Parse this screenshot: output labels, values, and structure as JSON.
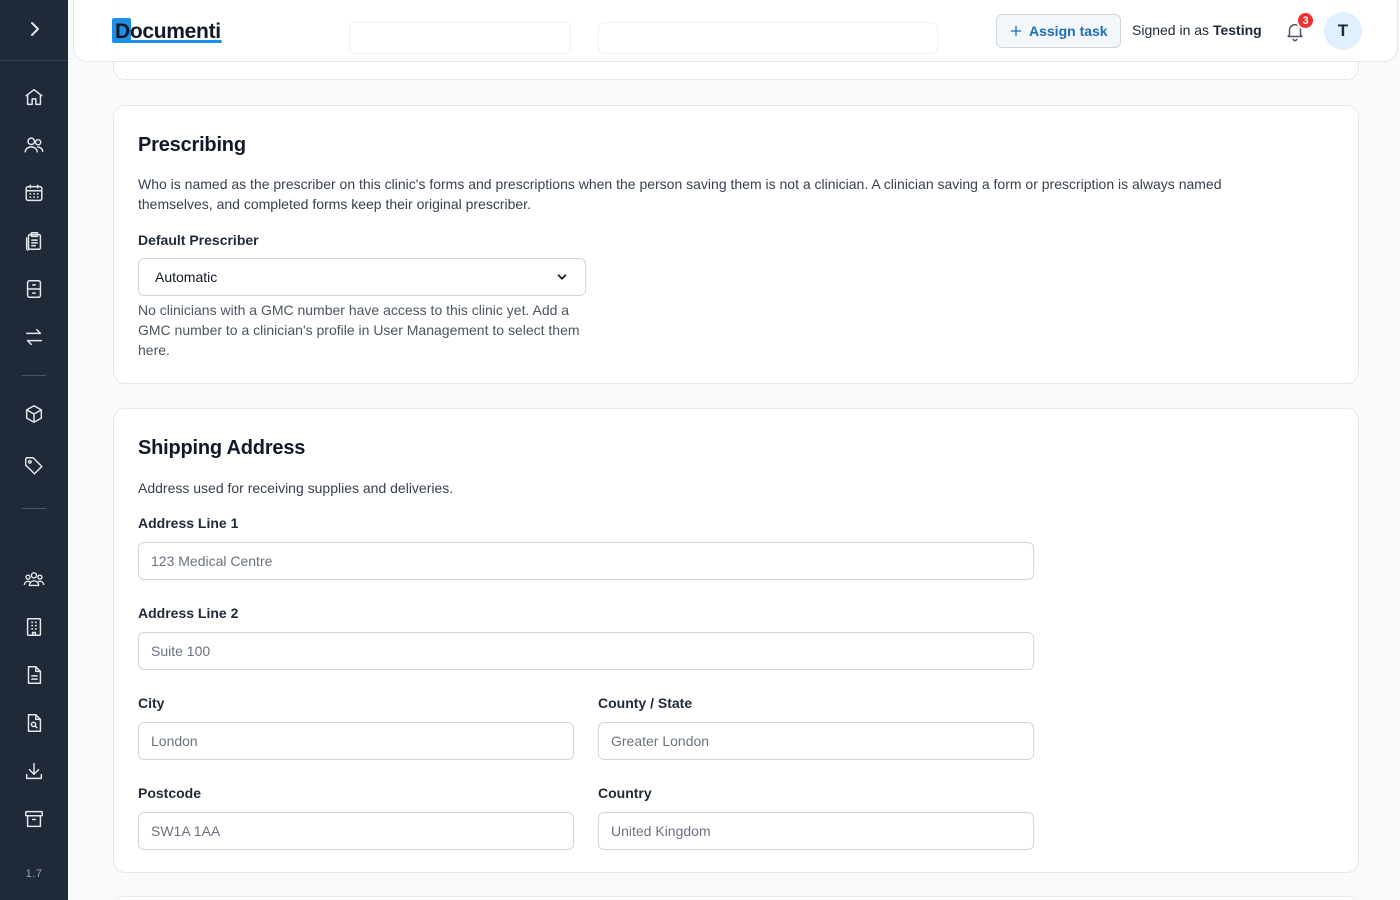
{
  "app": {
    "name": "Documenti",
    "version": "1.7"
  },
  "sidebar": {
    "items": [
      {
        "icon": "home-icon",
        "label": "Home"
      },
      {
        "icon": "users-icon",
        "label": "Patients"
      },
      {
        "icon": "calendar-icon",
        "label": "Calendar"
      },
      {
        "icon": "clipboard-icon",
        "label": "Forms"
      },
      {
        "icon": "cabinet-icon",
        "label": "Records"
      },
      {
        "icon": "transfer-icon",
        "label": "Transfers"
      },
      {
        "icon": "box-icon",
        "label": "Inventory"
      },
      {
        "icon": "tag-icon",
        "label": "Products"
      },
      {
        "icon": "team-icon",
        "label": "Team"
      },
      {
        "icon": "building-icon",
        "label": "Clinics"
      },
      {
        "icon": "document-icon",
        "label": "Documents"
      },
      {
        "icon": "search-document-icon",
        "label": "Audit"
      },
      {
        "icon": "download-icon",
        "label": "Downloads"
      },
      {
        "icon": "archive-icon",
        "label": "Archive"
      }
    ]
  },
  "header": {
    "assign_task_label": "Assign task",
    "signed_in_prefix": "Signed in as",
    "user_name": "Testing",
    "notification_count": "3",
    "avatar_initial": "T"
  },
  "prescribing": {
    "title": "Prescribing",
    "description": "Who is named as the prescriber on this clinic's forms and prescriptions when the person saving them is not a clinician. A clinician saving a form or prescription is always named themselves, and completed forms keep their original prescriber.",
    "default_prescriber_label": "Default Prescriber",
    "default_prescriber_value": "Automatic",
    "helper_text": "No clinicians with a GMC number have access to this clinic yet. Add a GMC number to a clinician's profile in User Management to select them here."
  },
  "shipping": {
    "title": "Shipping Address",
    "description": "Address used for receiving supplies and deliveries.",
    "address_line1": {
      "label": "Address Line 1",
      "placeholder": "123 Medical Centre"
    },
    "address_line2": {
      "label": "Address Line 2",
      "placeholder": "Suite 100"
    },
    "city": {
      "label": "City",
      "placeholder": "London"
    },
    "county": {
      "label": "County / State",
      "placeholder": "Greater London"
    },
    "postcode": {
      "label": "Postcode",
      "placeholder": "SW1A 1AA"
    },
    "country": {
      "label": "Country",
      "placeholder": "United Kingdom"
    }
  },
  "colors": {
    "sidebar_bg": "#1f2937",
    "accent": "#1d8fe6",
    "badge": "#ef2e2e"
  }
}
